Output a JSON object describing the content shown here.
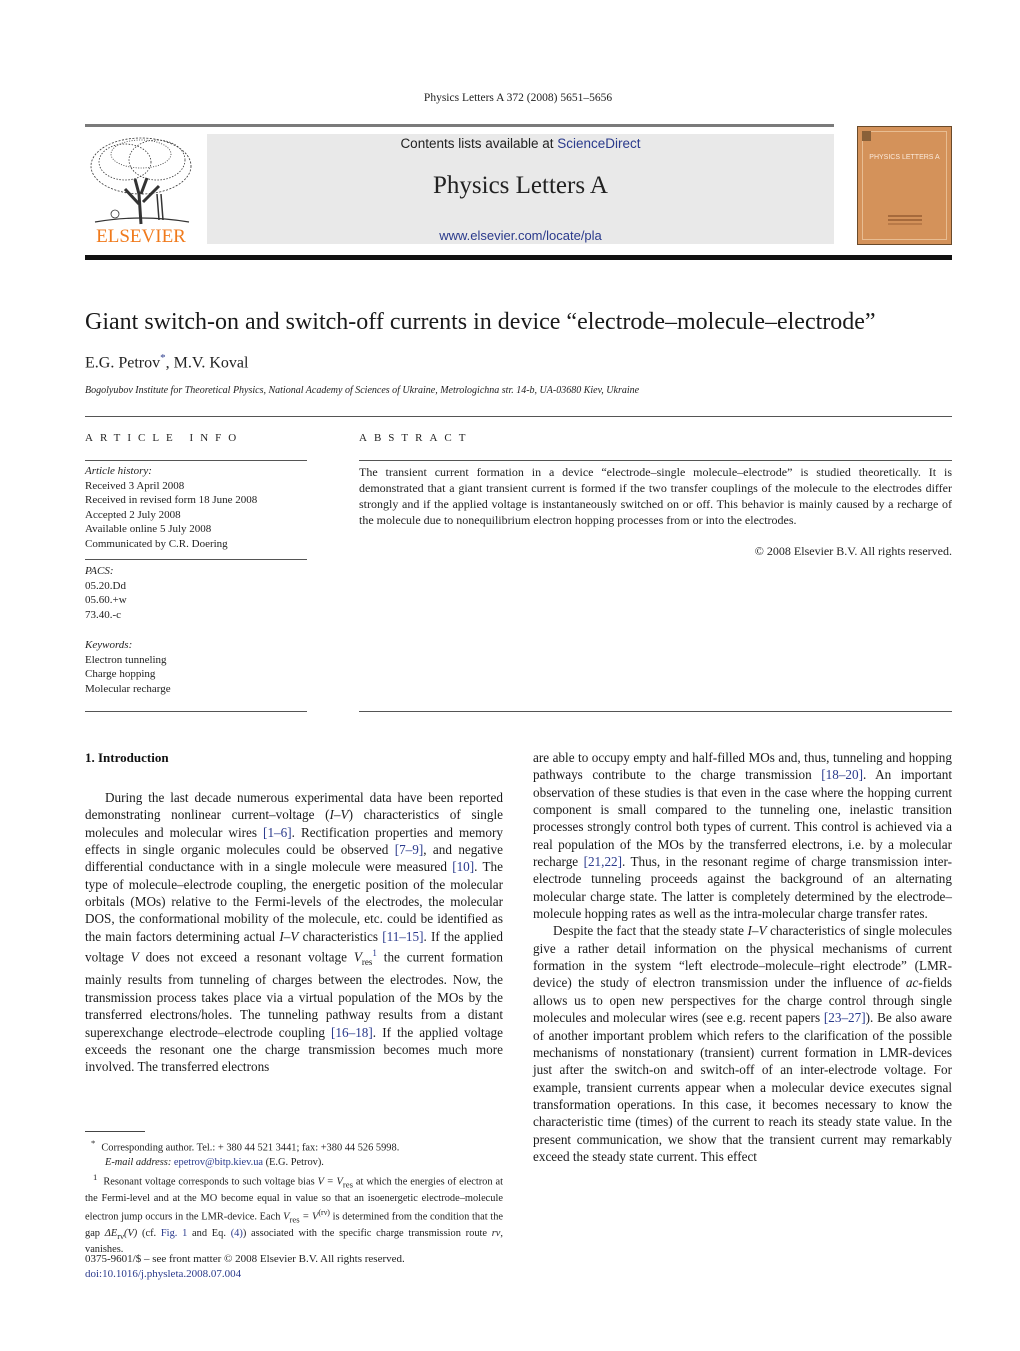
{
  "header": {
    "journal_ref": "Physics Letters A 372 (2008) 5651–5656",
    "contents_prefix": "Contents lists available at ",
    "contents_link": "ScienceDirect",
    "journal_title": "Physics Letters A",
    "journal_url": "www.elsevier.com/locate/pla",
    "publisher_logo_text": "ELSEVIER",
    "cover_title": "PHYSICS LETTERS A"
  },
  "article": {
    "title": "Giant switch-on and switch-off currents in device “electrode–molecule–electrode”",
    "authors": [
      {
        "name": "E.G. Petrov",
        "mark": "*"
      },
      {
        "name": "M.V. Koval",
        "mark": ""
      }
    ],
    "author_separator": ", ",
    "affiliation": "Bogolyubov Institute for Theoretical Physics, National Academy of Sciences of Ukraine, Metrologichna str. 14-b, UA-03680 Kiev, Ukraine"
  },
  "article_info": {
    "heading": "ARTICLE INFO",
    "history_label": "Article history:",
    "history": [
      "Received 3 April 2008",
      "Received in revised form 18 June 2008",
      "Accepted 2 July 2008",
      "Available online 5 July 2008",
      "Communicated by C.R. Doering"
    ],
    "pacs_label": "PACS:",
    "pacs": [
      "05.20.Dd",
      "05.60.+w",
      "73.40.-c"
    ],
    "keywords_label": "Keywords:",
    "keywords": [
      "Electron tunneling",
      "Charge hopping",
      "Molecular recharge"
    ]
  },
  "abstract": {
    "heading": "ABSTRACT",
    "text": "The transient current formation in a device “electrode–single molecule–electrode” is studied theoretically. It is demonstrated that a giant transient current is formed if the two transfer couplings of the molecule to the electrodes differ strongly and if the applied voltage is instantaneously switched on or off. This behavior is mainly caused by a recharge of the molecule due to nonequilibrium electron hopping processes from or into the electrodes.",
    "copyright": "© 2008 Elsevier B.V. All rights reserved."
  },
  "body": {
    "section_heading": "1. Introduction",
    "left_col": {
      "p1_a": "During the last decade numerous experimental data have been reported demonstrating nonlinear current–voltage (",
      "p1_iv": "I–V",
      "p1_b": ") characteristics of single molecules and molecular wires ",
      "ref_1_6": "[1–6]",
      "p1_c": ". Rectification properties and memory effects in single organic molecules could be observed ",
      "ref_7_9": "[7–9]",
      "p1_d": ", and negative differential conductance with in a single molecule were measured ",
      "ref_10": "[10]",
      "p1_e": ". The type of molecule–electrode coupling, the energetic position of the molecular orbitals (MOs) relative to the Fermi-levels of the electrodes, the molecular DOS, the conformational mobility of the molecule, etc. could be identified as the main factors determining actual ",
      "p1_iv2": "I–V",
      "p1_f": " characteristics ",
      "ref_11_15": "[11–15]",
      "p1_g": ". If the applied voltage ",
      "p1_v": "V",
      "p1_h": " does not exceed a resonant voltage ",
      "p1_vres": "V",
      "p1_vres_sub": "res",
      "p1_fn": "1",
      "p1_i": " the current formation mainly results from tunneling of charges between the electrodes. Now, the transmission process takes place via a virtual population of the MOs by the transferred electrons/holes. The tunneling pathway results from a distant superexchange electrode–electrode coupling ",
      "ref_16_18": "[16–18]",
      "p1_j": ". If the applied voltage exceeds the resonant one the charge transmission becomes much more involved. The transferred electrons"
    },
    "right_col": {
      "p1_a": "are able to occupy empty and half-filled MOs and, thus, tunneling and hopping pathways contribute to the charge transmission ",
      "ref_18_20": "[18–20]",
      "p1_b": ". An important observation of these studies is that even in the case where the hopping current component is small compared to the tunneling one, inelastic transition processes strongly control both types of current. This control is achieved via a real population of the MOs by the transferred electrons, i.e. by a molecular recharge ",
      "ref_21_22": "[21,22]",
      "p1_c": ". Thus, in the resonant regime of charge transmission inter-electrode tunneling proceeds against the background of an alternating molecular charge state. The latter is completely determined by the electrode–molecule hopping rates as well as the intra-molecular charge transfer rates.",
      "p2_a": "Despite the fact that the steady state ",
      "p2_iv": "I–V",
      "p2_b": " characteristics of single molecules give a rather detail information on the physical mechanisms of current formation in the system “left electrode–molecule–right electrode” (LMR-device) the study of electron transmission under the influence of ",
      "p2_ac": "ac",
      "p2_c": "-fields allows us to open new perspectives for the charge control through single molecules and molecular wires (see e.g. recent papers ",
      "ref_23_27": "[23–27]",
      "p2_d": "). Be also aware of another important problem which refers to the clarification of the possible mechanisms of nonstationary (transient) current formation in LMR-devices just after the switch-on and switch-off of an inter-electrode voltage. For example, transient currents appear when a molecular device executes signal transformation operations. In this case, it becomes necessary to know the characteristic time (times) of the current to reach its steady state value. In the present communication, we show that the transient current may remarkably exceed the steady state current. This effect"
    }
  },
  "footnotes": {
    "star_mark": "*",
    "corresponding": "Corresponding author. Tel.: + 380 44 521 3441; fax: +380 44 526 5998.",
    "email_label": "E-mail address: ",
    "email": "epetrov@bitp.kiev.ua",
    "email_suffix": " (E.G. Petrov).",
    "fn1_mark": "1",
    "fn1_a": "Resonant voltage corresponds to such voltage bias ",
    "fn1_eq1": "V = V",
    "fn1_eq1_sub": "res",
    "fn1_b": " at which the energies of electron at the Fermi-level and at the MO become equal in value so that an isoenergetic electrode–molecule electron jump occurs in the LMR-device. Each ",
    "fn1_eq2": "V",
    "fn1_eq2_sub": "res",
    "fn1_eq2_mid": " = V",
    "fn1_eq2_sup": "(rν)",
    "fn1_c": " is determined from the condition that the gap ",
    "fn1_gap": "ΔE",
    "fn1_gap_sub": "rν",
    "fn1_gap_arg": "(V)",
    "fn1_d": " (cf. ",
    "fig_link": "Fig. 1",
    "fn1_e": " and Eq. ",
    "eq_link": "(4)",
    "fn1_f": ") associated with the specific charge transmission route ",
    "fn1_route": "rν",
    "fn1_g": ", vanishes."
  },
  "front_matter": {
    "issn": "0375-9601/$ – see front matter  © 2008 Elsevier B.V. All rights reserved.",
    "doi": "doi:10.1016/j.physleta.2008.07.004"
  },
  "colors": {
    "link": "#2a3a8c",
    "elsevier_orange": "#f07a1c",
    "banner_gray": "#e9e9e9",
    "cover_orange": "#d4925a"
  }
}
